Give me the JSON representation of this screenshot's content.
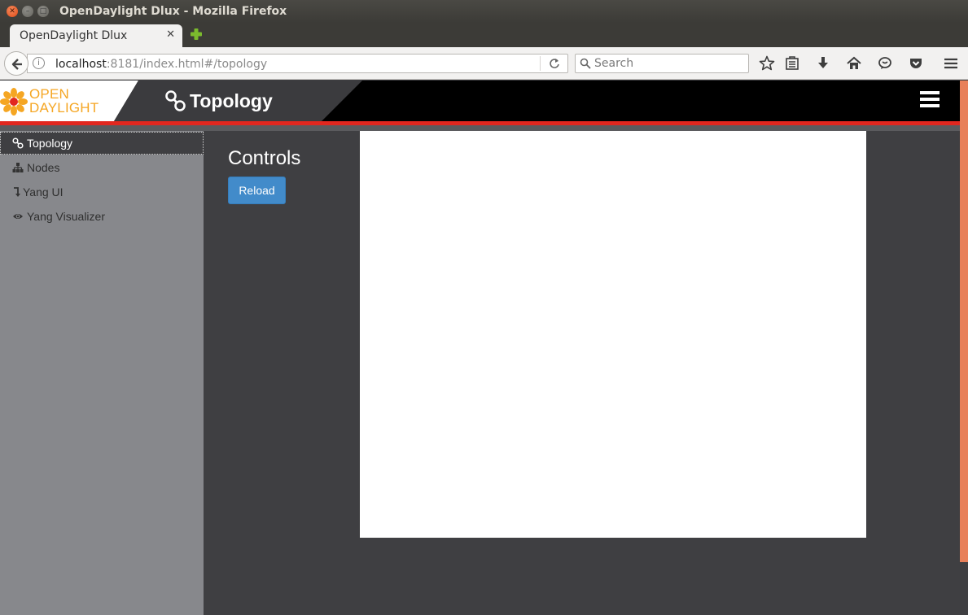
{
  "window": {
    "title": "OpenDaylight Dlux - Mozilla Firefox"
  },
  "tabs": [
    {
      "label": "OpenDaylight Dlux",
      "close": "✕"
    }
  ],
  "newtab": "+",
  "navbar": {
    "url_host": "localhost",
    "url_rest": ":8181/index.html#/topology",
    "search_placeholder": "Search"
  },
  "toolbar_icons": [
    "star-icon",
    "reading-list-icon",
    "download-icon",
    "home-icon",
    "chat-icon",
    "pocket-icon",
    "menu-icon"
  ],
  "header": {
    "logo_line1": "OPEN",
    "logo_line2": "DAYLIGHT",
    "page_title": "Topology"
  },
  "sidebar": {
    "items": [
      {
        "label": "Topology",
        "icon": "link-icon",
        "active": true
      },
      {
        "label": "Nodes",
        "icon": "sitemap-icon",
        "active": false
      },
      {
        "label": "Yang UI",
        "icon": "level-down-icon",
        "active": false
      },
      {
        "label": "Yang Visualizer",
        "icon": "eye-icon",
        "active": false
      }
    ]
  },
  "controls": {
    "title": "Controls",
    "reload_label": "Reload"
  },
  "colors": {
    "header_bg": "#000000",
    "accent_red": "#e2271f",
    "sidebar_bg": "#87888c",
    "content_bg": "#3f3f42",
    "button_blue": "#428bca",
    "logo_orange": "#f5a623"
  }
}
